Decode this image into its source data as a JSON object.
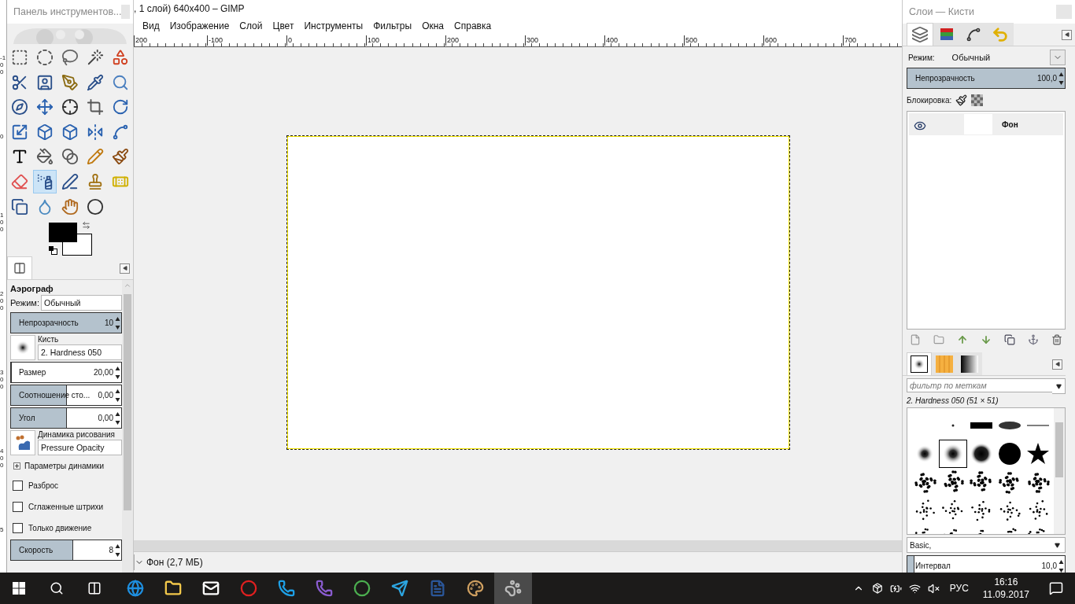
{
  "toolbox": {
    "title": "Панель инструментов...",
    "tools": [
      {
        "selected": false
      },
      {
        "selected": false
      },
      {
        "selected": false
      },
      {
        "selected": false
      },
      {
        "selected": false
      },
      {
        "selected": false
      },
      {
        "selected": false
      },
      {
        "selected": false
      },
      {
        "selected": false
      },
      {
        "selected": false
      },
      {
        "selected": false
      },
      {
        "selected": false
      },
      {
        "selected": false
      },
      {
        "selected": false
      },
      {
        "selected": false
      },
      {
        "selected": false
      },
      {
        "selected": false
      },
      {
        "selected": false
      },
      {
        "selected": false
      },
      {
        "selected": false
      },
      {
        "selected": false
      },
      {
        "selected": false
      },
      {
        "selected": false
      },
      {
        "selected": false
      },
      {
        "selected": false
      },
      {
        "selected": false
      },
      {
        "selected": true
      },
      {
        "selected": false
      },
      {
        "selected": false
      },
      {
        "selected": false
      },
      {
        "selected": false
      },
      {
        "selected": false
      },
      {
        "selected": false
      },
      {
        "selected": false
      }
    ]
  },
  "vertical_ruler": [
    "-100",
    "0",
    "100",
    "200",
    "300",
    "400",
    "5"
  ],
  "tool_options": {
    "title": "Аэрограф",
    "mode": {
      "label": "Режим:",
      "value": "Обычный"
    },
    "opacity": {
      "label": "Непрозрачность",
      "reading": "10",
      "level": 1
    },
    "brush": {
      "label": "Кисть",
      "value": "2. Hardness 050"
    },
    "sliders": [
      {
        "label": "Размер",
        "reading": "20,00",
        "level": 0.0
      },
      {
        "label": "Соотношение сто...",
        "reading": "0,00",
        "level": 0.5
      },
      {
        "label": "Угол",
        "reading": "0,00",
        "level": 0.5
      }
    ],
    "dynamics": {
      "label": "Динамика рисования",
      "value": "Pressure Opacity"
    },
    "dynamics_options": {
      "label": "Параметры динамики",
      "expanded": false
    },
    "checkboxes": [
      {
        "label": "Разброс",
        "checked": false
      },
      {
        "label": "Сглаженные штрихи",
        "checked": false
      },
      {
        "label": "Только движение",
        "checked": false
      }
    ],
    "speed": {
      "label": "Скорость",
      "reading": "8",
      "level": 0.56
    }
  },
  "image_window": {
    "title": ", 1 слой) 640x400 – GIMP",
    "menu": [
      "Вид",
      "Изображение",
      "Слой",
      "Цвет",
      "Инструменты",
      "Фильтры",
      "Окна",
      "Справка"
    ],
    "ruler": [
      "200",
      "-100",
      "0",
      "100",
      "200",
      "300",
      "400",
      "500",
      "600",
      "700"
    ],
    "status": "Фон (2,7 МБ)"
  },
  "dock": {
    "title": "Слои — Кисти",
    "tabs": [
      {
        "selected": true
      },
      {
        "selected": false
      },
      {
        "selected": false
      },
      {
        "selected": false
      }
    ],
    "mode": {
      "label": "Режим:",
      "value": "Обычный"
    },
    "opacity": {
      "label": "Непрозрачность",
      "reading": "100,0",
      "level": 1
    },
    "lock_label": "Блокировка:",
    "layers": [
      {
        "name": "Фон",
        "visible": true,
        "selected": true
      }
    ],
    "brush_tabs": [
      {
        "selected": true
      },
      {
        "selected": false
      },
      {
        "selected": false
      }
    ],
    "filter": {
      "placeholder": "фильтр по меткам"
    },
    "brush_name": "2. Hardness 050 (51 × 51)",
    "brushes": [
      {
        "selected": false
      },
      {
        "selected": false
      },
      {
        "selected": false
      },
      {
        "selected": false
      },
      {
        "selected": false
      },
      {
        "selected": true
      },
      {
        "selected": false
      },
      {
        "selected": false
      },
      {
        "selected": false
      },
      {
        "selected": false
      },
      {
        "selected": false
      },
      {
        "selected": false
      },
      {
        "selected": false
      },
      {
        "selected": false
      },
      {
        "selected": false
      },
      {
        "selected": false
      },
      {
        "selected": false
      },
      {
        "selected": false
      },
      {
        "selected": false
      },
      {
        "selected": false
      },
      {
        "selected": false
      },
      {
        "selected": false
      },
      {
        "selected": false
      },
      {
        "selected": false
      }
    ],
    "brush_set": "Basic,",
    "spacing": {
      "label": "Интервал",
      "reading": "10,0",
      "level": 0.04
    }
  },
  "taskbar": {
    "apps": [
      {
        "selected": false
      },
      {
        "selected": false
      },
      {
        "selected": false
      },
      {
        "selected": false
      },
      {
        "selected": false
      },
      {
        "selected": false
      },
      {
        "selected": false
      },
      {
        "selected": false
      },
      {
        "selected": false
      },
      {
        "selected": false
      },
      {
        "selected": true
      }
    ],
    "language": "РУС",
    "time": "16:16",
    "date": "11.09.2017"
  }
}
